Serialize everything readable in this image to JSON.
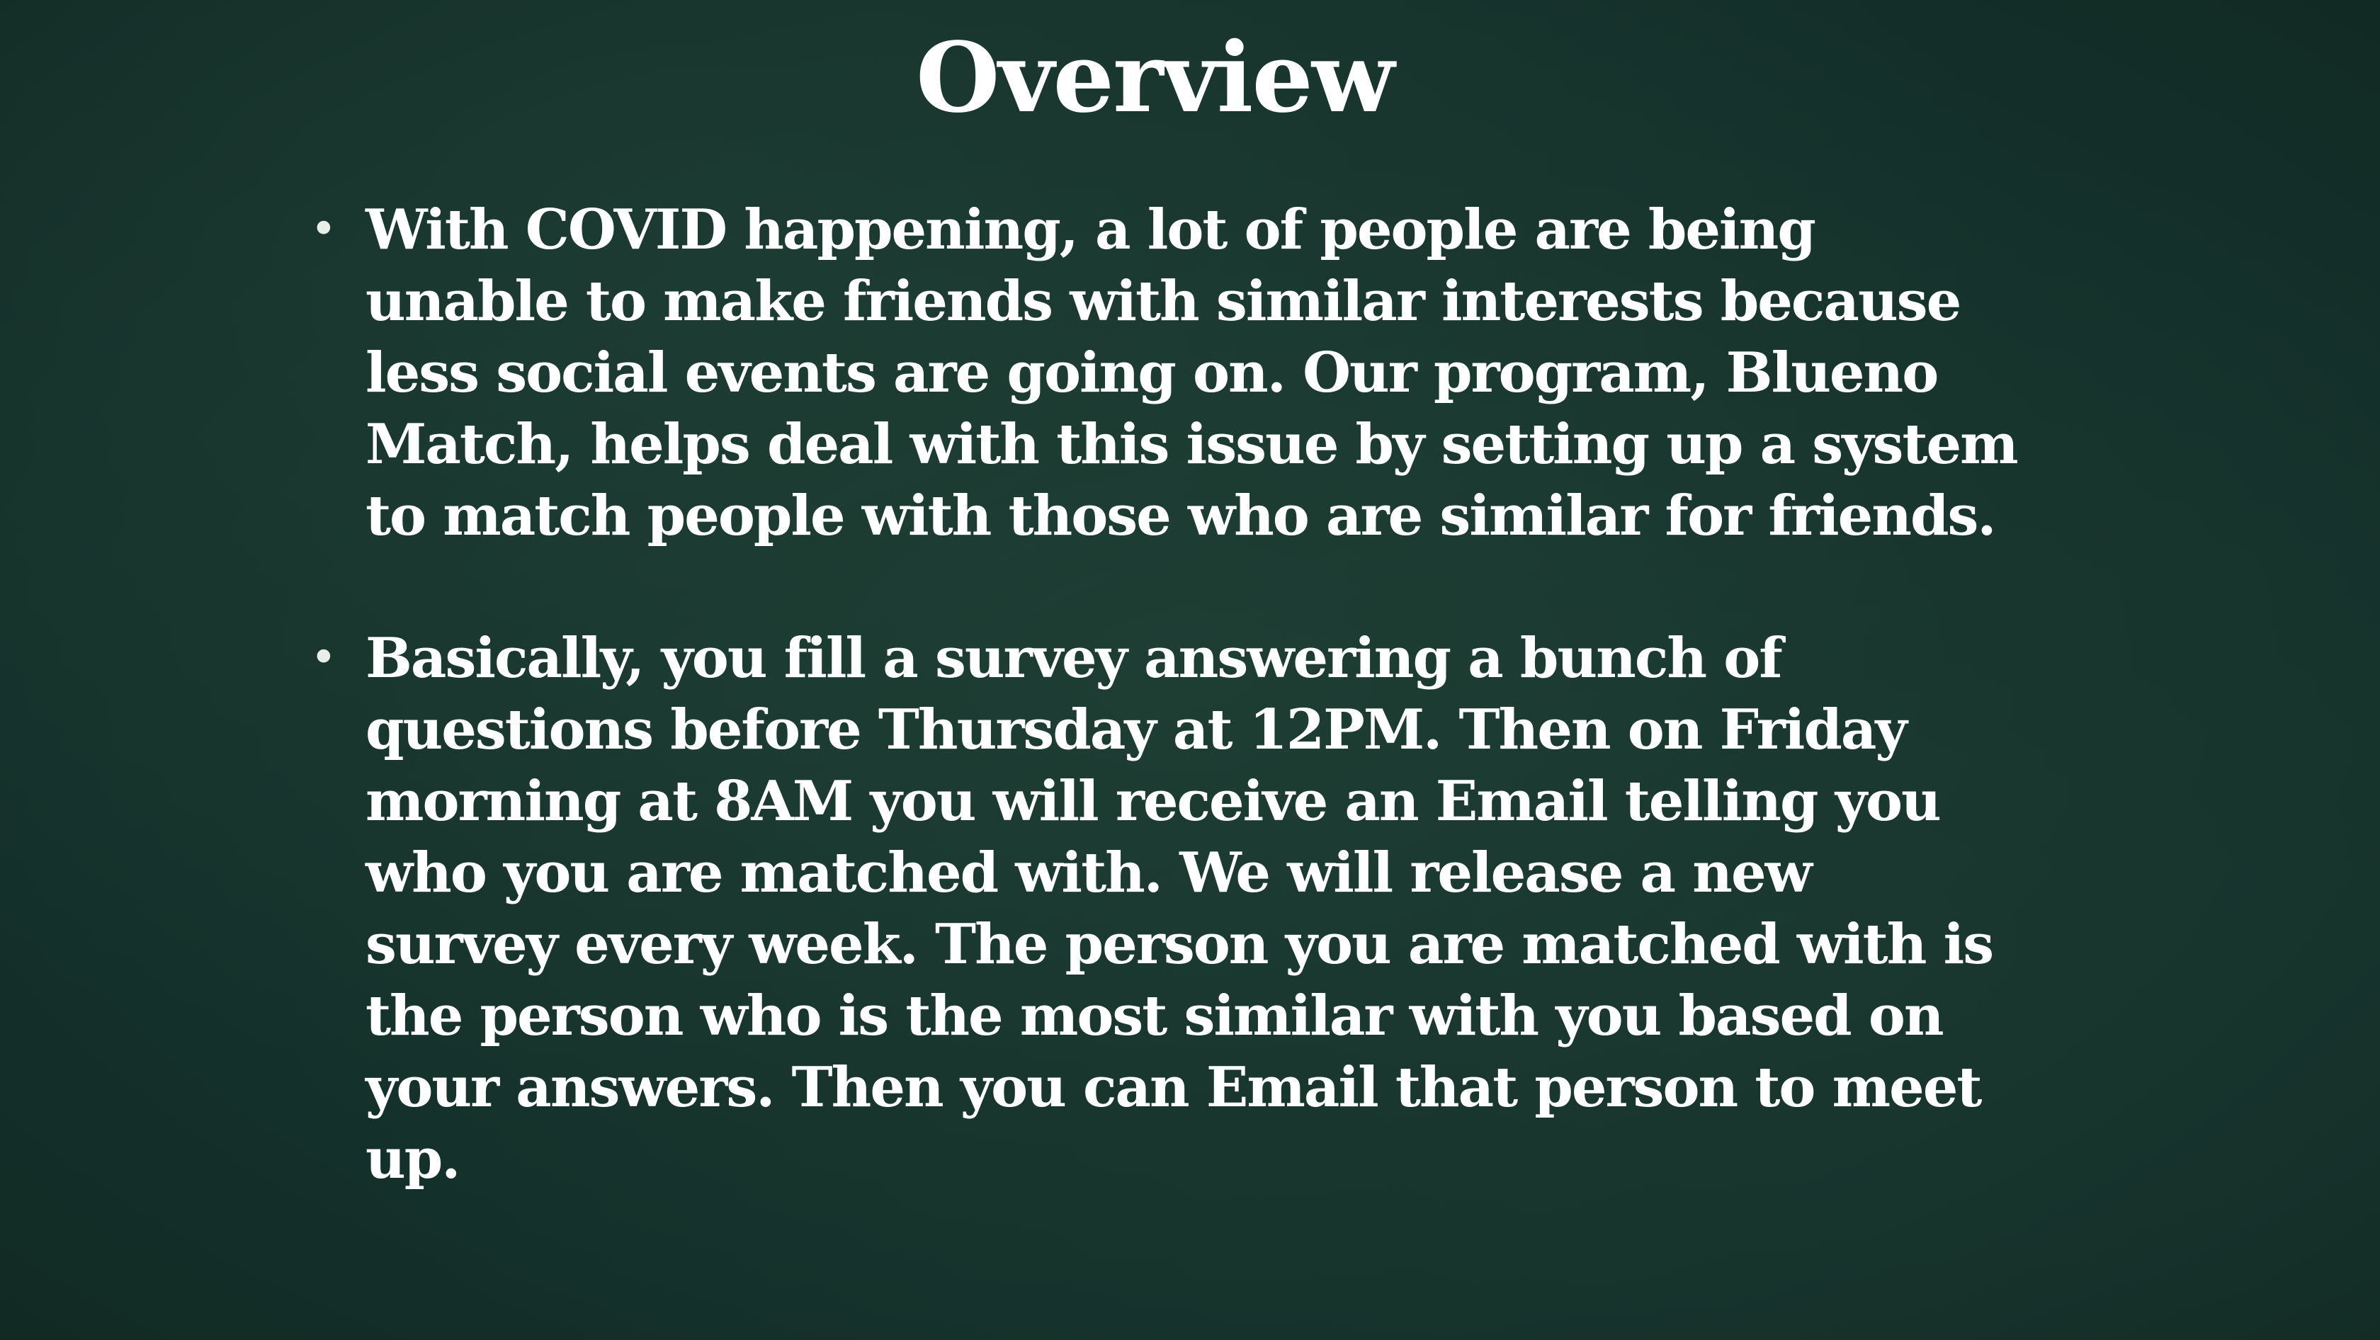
{
  "slide": {
    "title": "Overview",
    "bullets": [
      {
        "marker": "•",
        "text": "With COVID happening, a lot of people are being unable to make friends with similar interests because less social events are going on. Our program, Blueno Match, helps deal with this issue by setting up a system to match people with those who are similar for friends."
      },
      {
        "marker": "•",
        "text": "Basically, you fill a survey answering a bunch of questions before Thursday at 12PM. Then on Friday morning at 8AM you will receive an Email telling you who you are matched with. We will release a new survey every week. The person you are matched with is the person who is the most similar with you based on your answers. Then you can Email that person to meet up."
      }
    ]
  },
  "colors": {
    "background": "#17332b",
    "text": "#ffffff"
  }
}
